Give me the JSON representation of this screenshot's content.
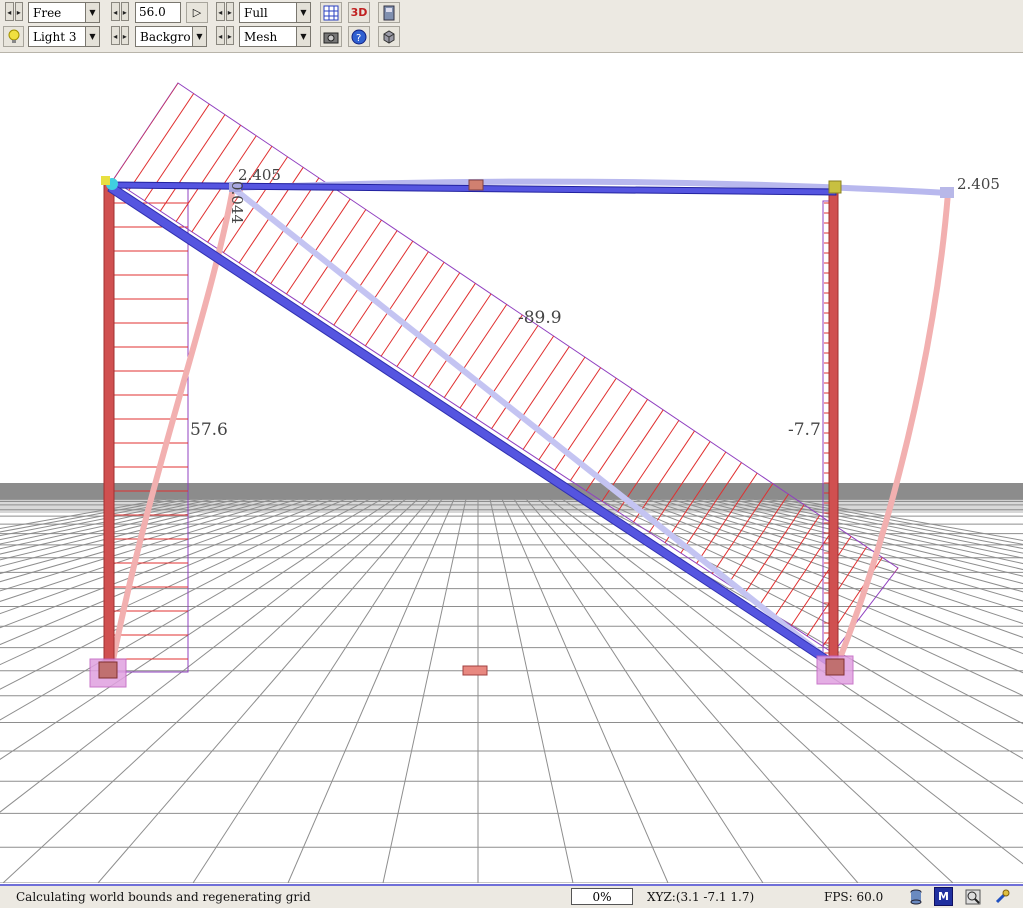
{
  "toolbar": {
    "row1": {
      "view_mode": "Free",
      "angle_value": "56.0",
      "render_mode": "Full"
    },
    "row2": {
      "light": "Light 3",
      "background": "Backgro",
      "mesh": "Mesh"
    },
    "icons": {
      "grid": "grid-icon",
      "three_d": "3D",
      "save": "save-icon",
      "camera": "camera-icon",
      "help": "help-icon",
      "cube": "cube-icon"
    }
  },
  "viewport": {
    "labels": {
      "column_left_moment": "57.6",
      "diagonal_moment": "-89.9",
      "column_right_moment": "-7.7",
      "vertical_label": "0.044",
      "displacement_left": "2.405",
      "displacement_right": "2.405"
    },
    "colors": {
      "beam": "#5555e0",
      "column": "#d05050",
      "hatch": "#e03030",
      "outline": "#9040c0",
      "support": "#d68ad6",
      "node": "#d8d040"
    }
  },
  "status": {
    "message": "Calculating world bounds and regenerating grid",
    "progress": "0%",
    "xyz": "XYZ:(3.1 -7.1 1.7)",
    "fps": "FPS: 60.0",
    "m_label": "M"
  }
}
